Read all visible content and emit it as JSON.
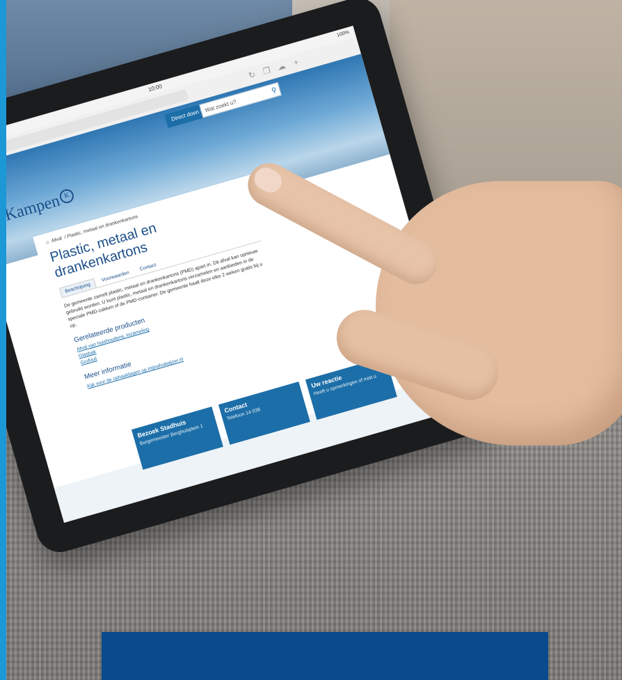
{
  "photo": {
    "tablet": {
      "status_time": "10:00",
      "battery": "100%",
      "site": {
        "logo_text": "Kampen",
        "logo_mark": "K",
        "direct_doen": "Direct doen ▾",
        "search_placeholder": "Wat zoekt u?",
        "breadcrumb": [
          "Afval",
          "Plastic, metaal en drankenkartons"
        ],
        "title": "Plastic, metaal en drankenkartons",
        "tabs": [
          "Beschrijving",
          "Voorwaarden",
          "Contact"
        ],
        "description": "De gemeente zamelt plastic, metaal en drankenkartons (PMD) apart in. Dit afval kan opnieuw gebruikt worden. U kunt plastic, metaal en drankenkartons verzamelen en aanbieden in de speciale PMD-zakken of de PMD-container. De gemeente haalt deze elke 2 weken gratis bij u op.",
        "related_heading": "Gerelateerde producten",
        "related_links": [
          "Afval van huishoudens, inzameling",
          "Glasbak",
          "Grofvuil"
        ],
        "more_heading": "Meer informatie",
        "more_links": [
          "Kijk voor de ophaaldagen op mijnafvalwijzer.nl"
        ],
        "tiles": [
          {
            "title": "Bezoek Stadhuis",
            "subtitle": "Burgemeester Berghuisplein 1"
          },
          {
            "title": "Contact",
            "subtitle": "Telefoon 14 038"
          },
          {
            "title": "Uw reactie",
            "subtitle": "Heeft u opmerkingen of mist u"
          }
        ]
      }
    }
  },
  "colors": {
    "brand_blue": "#1c6ea8",
    "banner_blue": "#0b4b8d",
    "accent_strip": "#1b98d5"
  }
}
